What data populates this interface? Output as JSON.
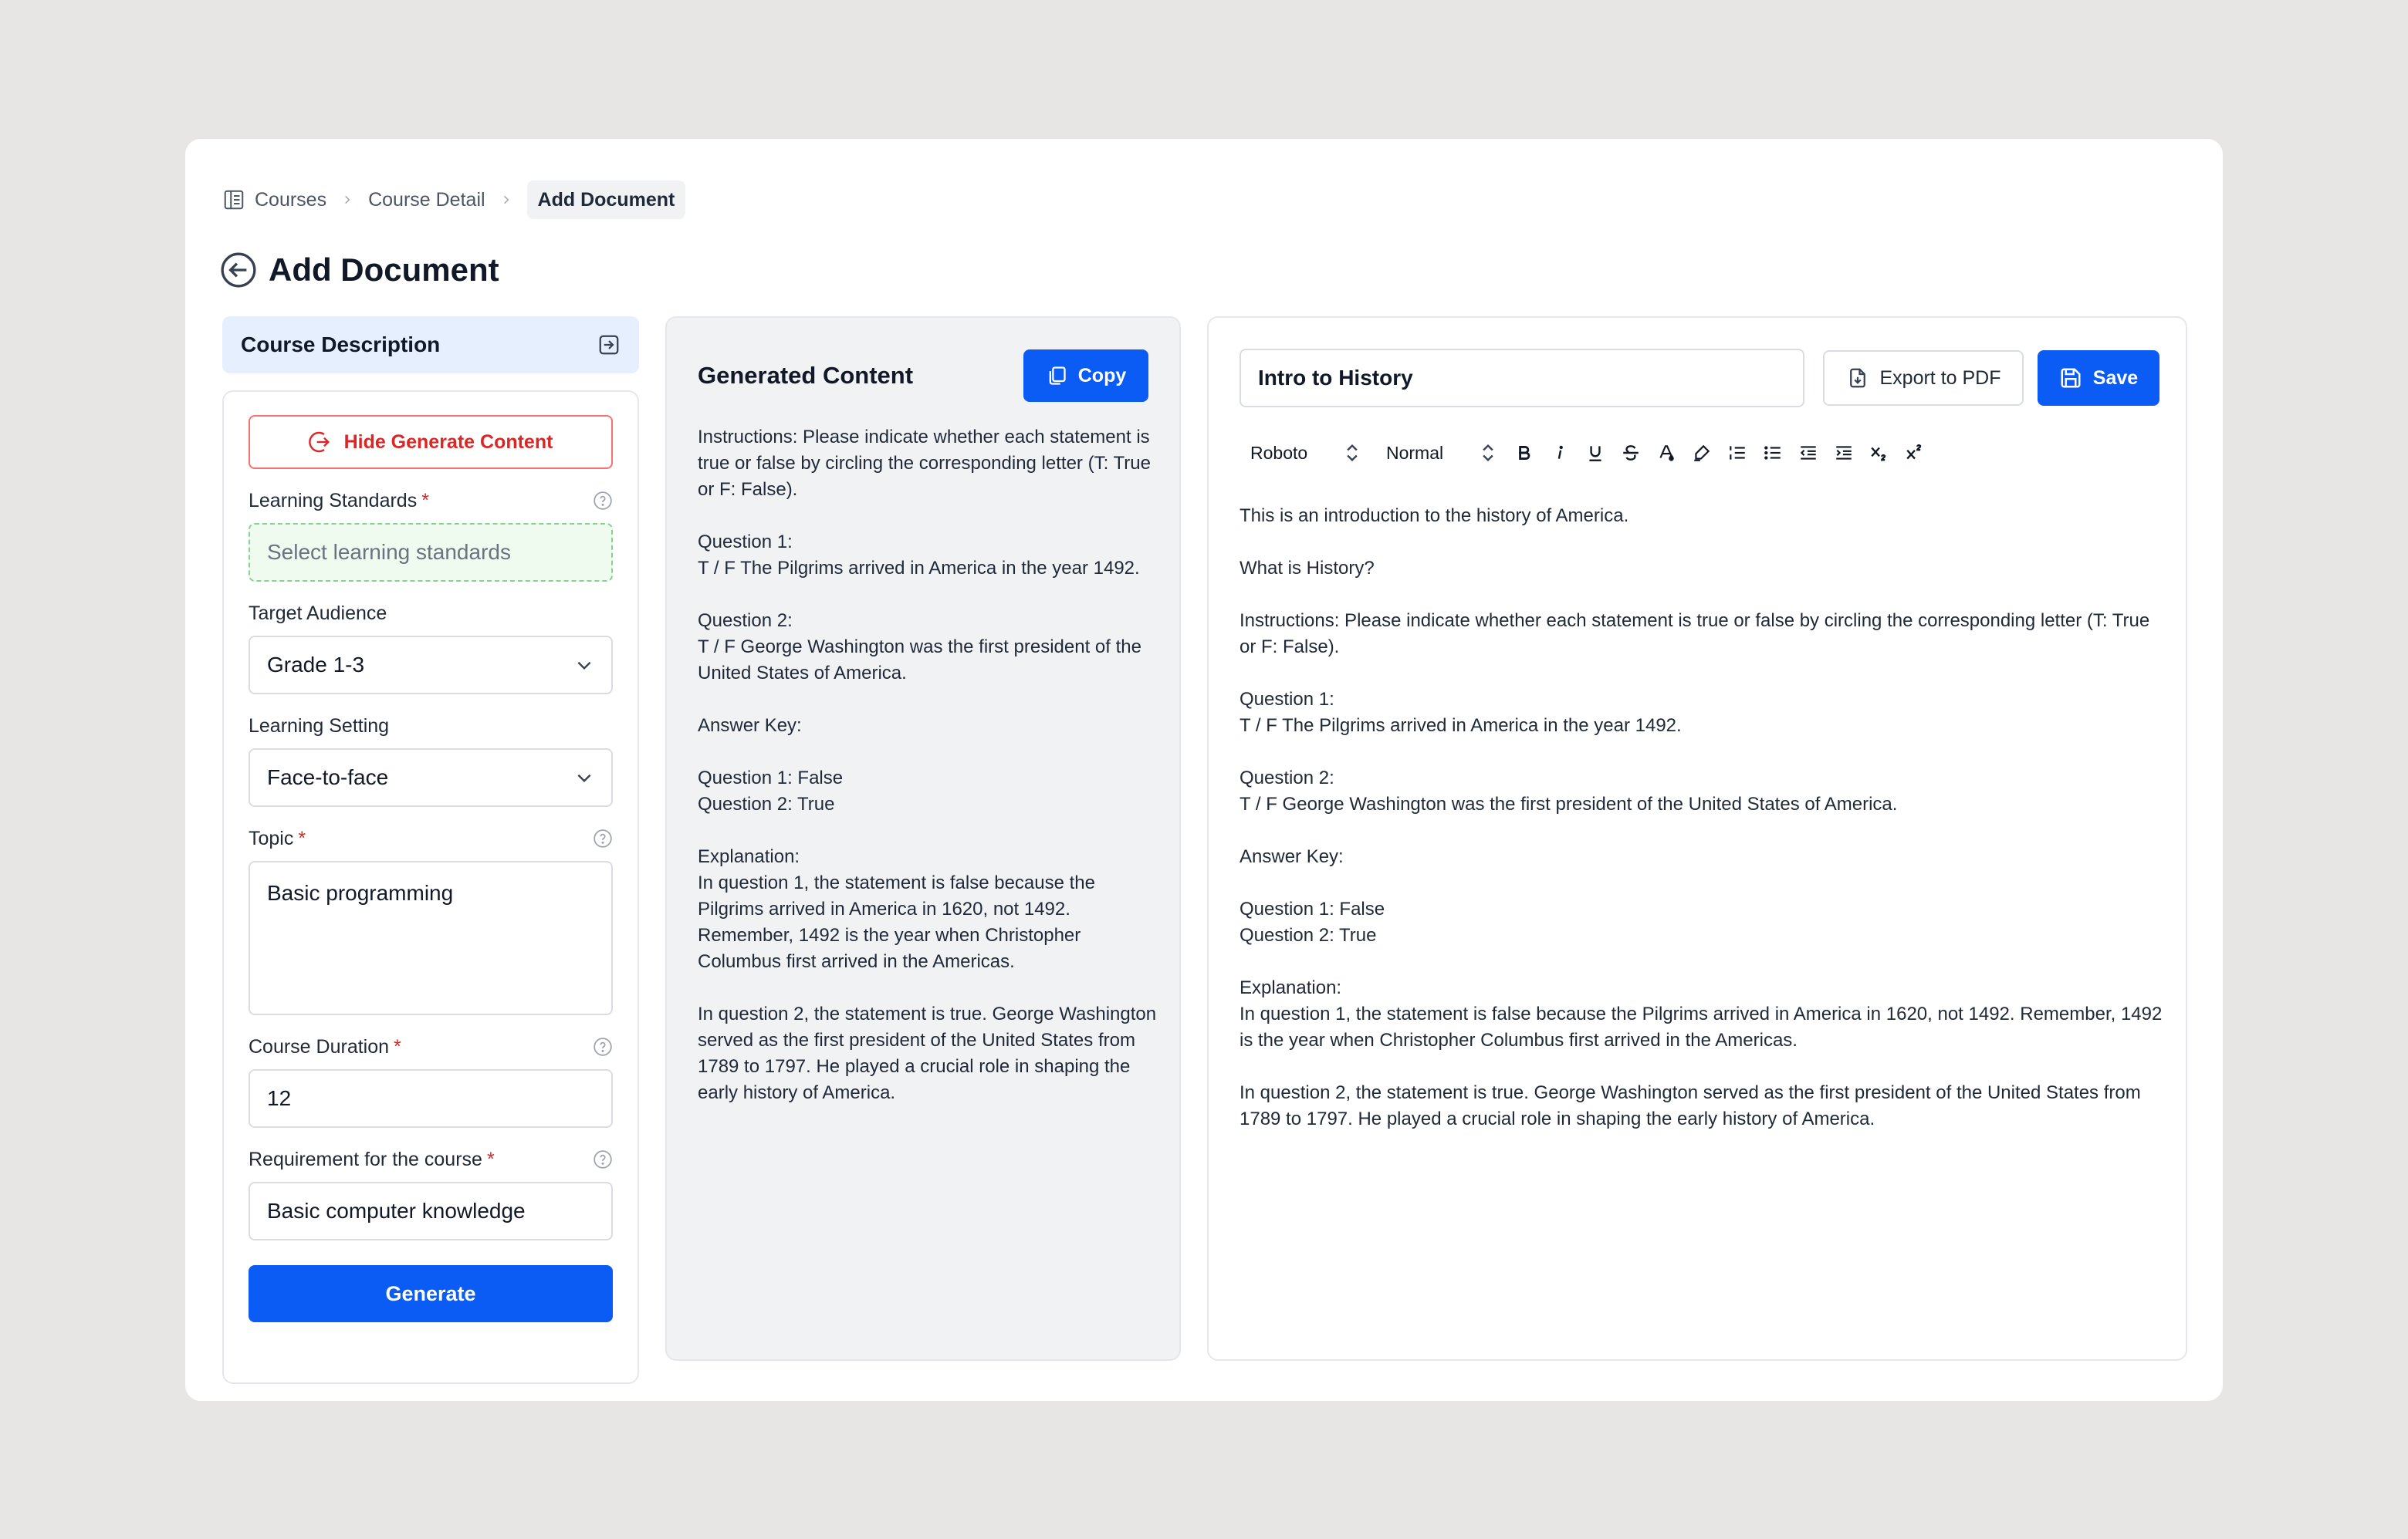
{
  "breadcrumb": {
    "items": [
      "Courses",
      "Course Detail"
    ],
    "current": "Add Document"
  },
  "page": {
    "title": "Add Document"
  },
  "course_description": {
    "title": "Course Description",
    "hide_button": "Hide Generate Content",
    "learning_standards": {
      "label": "Learning Standards",
      "placeholder": "Select learning standards"
    },
    "target_audience": {
      "label": "Target Audience",
      "value": "Grade 1-3"
    },
    "learning_setting": {
      "label": "Learning Setting",
      "value": "Face-to-face"
    },
    "topic": {
      "label": "Topic",
      "value": "Basic programming"
    },
    "course_duration": {
      "label": "Course Duration",
      "value": "12"
    },
    "requirement": {
      "label": "Requirement for the course",
      "value": "Basic computer knowledge"
    },
    "required_mark": "*",
    "generate_button": "Generate"
  },
  "generated": {
    "title": "Generated Content",
    "copy_button": "Copy",
    "paragraphs": [
      "Instructions: Please indicate whether each statement is true or false by circling the corresponding letter (T: True or F: False).",
      "Question 1:\nT / F The Pilgrims arrived in America in the year 1492.",
      "Question 2:\nT / F George Washington was the first president of the United States of America.",
      "Answer Key:",
      "Question 1: False\nQuestion 2: True",
      "Explanation:\nIn question 1, the statement is false because the Pilgrims arrived in America in 1620, not 1492. Remember, 1492 is the year when Christopher Columbus first arrived in the Americas.",
      "In question 2, the statement is true. George Washington served as the first president of the United States from 1789 to 1797. He played a crucial role in shaping the early history of America."
    ]
  },
  "editor": {
    "doc_title": "Intro to History",
    "export_button": "Export to PDF",
    "save_button": "Save",
    "font_select": "Roboto",
    "size_select": "Normal",
    "toolbar_icons": [
      "bold-icon",
      "italic-icon",
      "underline-icon",
      "strikethrough-icon",
      "text-color-icon",
      "highlight-icon",
      "ordered-list-icon",
      "bullet-list-icon",
      "indent-decrease-icon",
      "indent-increase-icon",
      "subscript-icon",
      "superscript-icon"
    ],
    "paragraphs": [
      "This is an introduction to the history of America.",
      "What is History?",
      "Instructions: Please indicate whether each statement is true or false by circling the corresponding letter (T: True or F: False).",
      "Question 1:\nT / F The Pilgrims arrived in America in the year 1492.",
      "Question 2:\nT / F George Washington was the first president of the United States of America.",
      "Answer Key:",
      "Question 1: False\nQuestion 2: True",
      "Explanation:\nIn question 1, the statement is false because the Pilgrims arrived in America in 1620, not 1492. Remember, 1492 is the year when Christopher Columbus first arrived in the Americas.",
      "In question 2, the statement is true. George Washington served as the first president of the United States from 1789 to 1797. He played a crucial role in shaping the early history of America."
    ]
  },
  "colors": {
    "primary": "#0a5cf5",
    "danger": "#dc2626",
    "panel": "#f1f2f4",
    "header_tint": "#e6effd"
  }
}
